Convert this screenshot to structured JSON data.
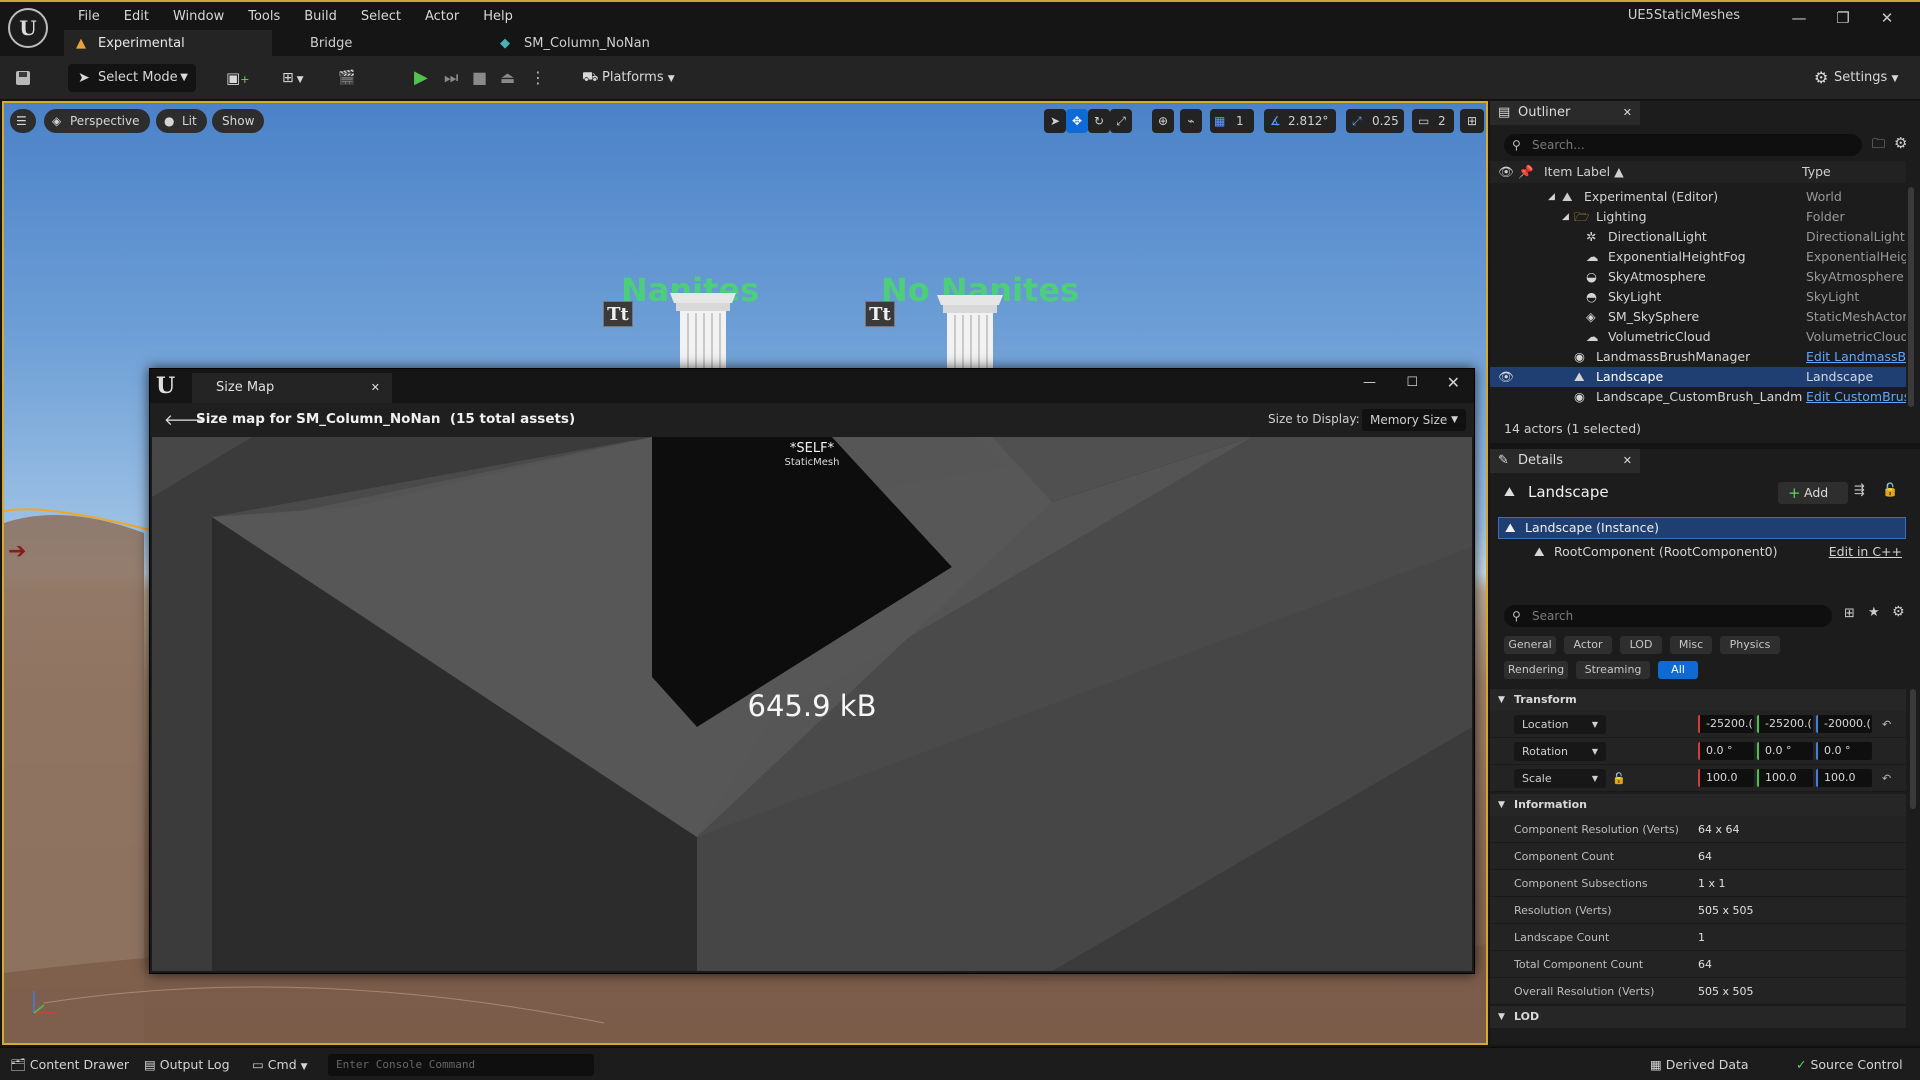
{
  "menu": [
    "File",
    "Edit",
    "Window",
    "Tools",
    "Build",
    "Select",
    "Actor",
    "Help"
  ],
  "tabs": {
    "experimental": "Experimental",
    "bridge": "Bridge",
    "asset": "SM_Column_NoNan"
  },
  "project_title": "UE5StaticMeshes",
  "toolbar": {
    "select_mode": "Select Mode",
    "platforms": "Platforms",
    "settings": "Settings"
  },
  "viewport": {
    "perspective": "Perspective",
    "lit": "Lit",
    "show": "Show",
    "angle_snap": "2.812°",
    "scale_snap": "0.25",
    "grid_snap": "1",
    "camera_speed": "2",
    "label_nanites": "Nanites",
    "label_no_nanites": "No Nanites",
    "text_render_icon": "Tt"
  },
  "size_map": {
    "tab_title": "Size Map",
    "header": "Size map for SM_Column_NoNan  (15 total assets)",
    "size_to_display_label": "Size to Display:",
    "size_to_display_value": "Memory Size",
    "self_label": "*SELF*",
    "self_type": "StaticMesh",
    "size_value": "645.9 kB"
  },
  "outliner": {
    "title": "Outliner",
    "search_placeholder": "Search...",
    "col_label": "Item Label",
    "col_type": "Type",
    "rows": [
      {
        "label": "Experimental (Editor)",
        "type": "World"
      },
      {
        "label": "Lighting",
        "type": "Folder"
      },
      {
        "label": "DirectionalLight",
        "type": "DirectionalLight"
      },
      {
        "label": "ExponentialHeightFog",
        "type": "ExponentialHeigh"
      },
      {
        "label": "SkyAtmosphere",
        "type": "SkyAtmosphere"
      },
      {
        "label": "SkyLight",
        "type": "SkyLight"
      },
      {
        "label": "SM_SkySphere",
        "type": "StaticMeshActor"
      },
      {
        "label": "VolumetricCloud",
        "type": "VolumetricCloud"
      },
      {
        "label": "LandmassBrushManager",
        "type": "Edit LandmassB"
      },
      {
        "label": "Landscape",
        "type": "Landscape"
      },
      {
        "label": "Landscape_CustomBrush_Landma:",
        "type": "Edit CustomBrus"
      }
    ],
    "footer": "14 actors (1 selected)"
  },
  "details": {
    "title": "Details",
    "actor_name": "Landscape",
    "add_button": "Add",
    "instance": "Landscape (Instance)",
    "root_component": "RootComponent (RootComponent0)",
    "edit_cpp": "Edit in C++",
    "search_placeholder": "Search",
    "categories_row1": [
      "General",
      "Actor",
      "LOD",
      "Misc",
      "Physics"
    ],
    "categories_row2": [
      "Rendering",
      "Streaming",
      "All"
    ],
    "transform_title": "Transform",
    "location": {
      "label": "Location",
      "x": "-25200.(",
      "y": "-25200.(",
      "z": "-20000.("
    },
    "rotation": {
      "label": "Rotation",
      "x": "0.0 °",
      "y": "0.0 °",
      "z": "0.0 °"
    },
    "scale": {
      "label": "Scale",
      "x": "100.0",
      "y": "100.0",
      "z": "100.0"
    },
    "information_title": "Information",
    "info": [
      {
        "label": "Component Resolution (Verts)",
        "value": "64 x 64"
      },
      {
        "label": "Component Count",
        "value": "64"
      },
      {
        "label": "Component Subsections",
        "value": "1 x 1"
      },
      {
        "label": "Resolution (Verts)",
        "value": "505 x 505"
      },
      {
        "label": "Landscape Count",
        "value": "1"
      },
      {
        "label": "Total Component Count",
        "value": "64"
      },
      {
        "label": "Overall Resolution (Verts)",
        "value": "505 x 505"
      }
    ],
    "lod_title": "LOD"
  },
  "statusbar": {
    "content_drawer": "Content Drawer",
    "output_log": "Output Log",
    "cmd": "Cmd",
    "console_placeholder": "Enter Console Command",
    "derived_data": "Derived Data",
    "source_control": "Source Control"
  },
  "colors": {
    "accent": "#0e6ad4",
    "viewport_border": "#d7a92c",
    "selection": "#1f3f73",
    "label_green": "#48d86b"
  }
}
